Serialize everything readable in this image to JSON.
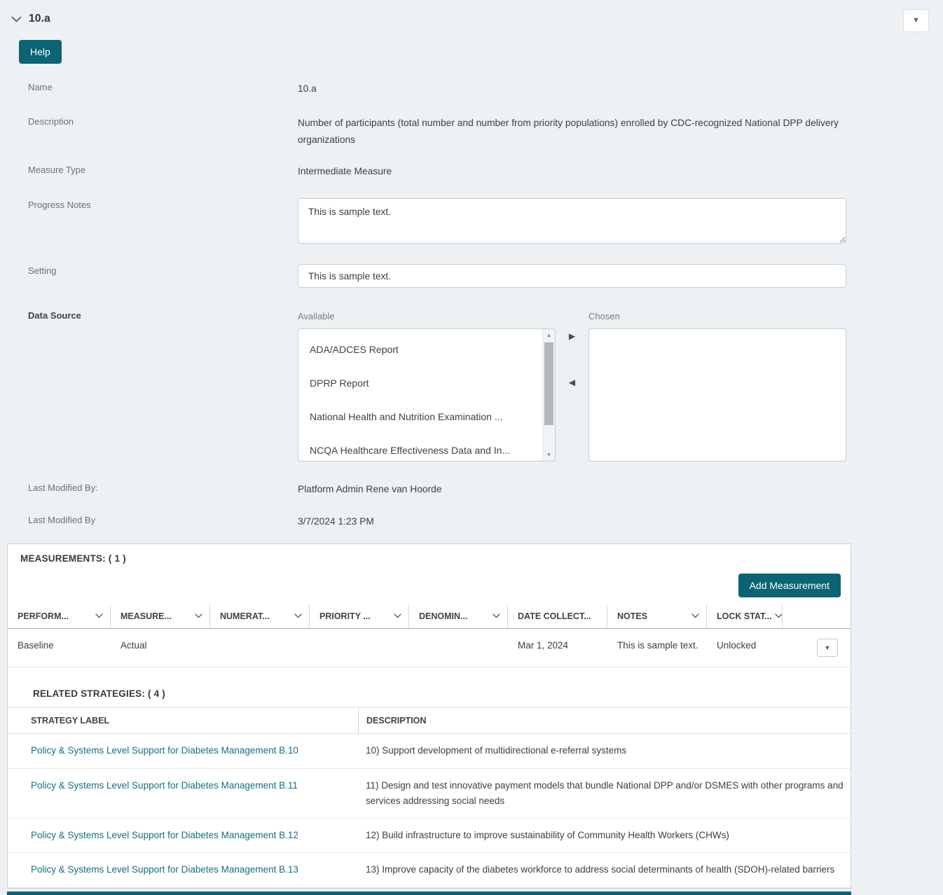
{
  "colors": {
    "accent": "#0a6473",
    "link": "#146f81",
    "page_bg": "#edf1f3"
  },
  "section": {
    "title": "10.a"
  },
  "toolbar": {
    "help_label": "Help"
  },
  "fields": {
    "name": {
      "label": "Name",
      "value": "10.a"
    },
    "description": {
      "label": "Description",
      "value": "Number of participants (total number and number from priority populations) enrolled by CDC-recognized National DPP delivery organizations"
    },
    "measure_type": {
      "label": "Measure Type",
      "value": "Intermediate Measure"
    },
    "progress_notes": {
      "label": "Progress Notes",
      "value": "This is sample text."
    },
    "setting": {
      "label": "Setting",
      "value": "This is sample text."
    },
    "data_source": {
      "label": "Data Source",
      "available_label": "Available",
      "chosen_label": "Chosen",
      "available_options": [
        "ADA/ADCES Report",
        "DPRP Report",
        "National Health and Nutrition Examination ...",
        "NCQA Healthcare Effectiveness Data and In..."
      ],
      "chosen_options": []
    },
    "last_modified_by_user": {
      "label": "Last Modified By:",
      "value": "Platform Admin Rene van Hoorde"
    },
    "last_modified_by_date": {
      "label": "Last Modified By",
      "value": "3/7/2024 1:23 PM"
    }
  },
  "measurements": {
    "title": "MEASUREMENTS: ( 1 )",
    "add_button_label": "Add Measurement",
    "columns": [
      {
        "label": "PERFORM...",
        "sortable": true
      },
      {
        "label": "MEASURE...",
        "sortable": true
      },
      {
        "label": "NUMERAT...",
        "sortable": true
      },
      {
        "label": "PRIORITY ...",
        "sortable": true
      },
      {
        "label": "DENOMIN...",
        "sortable": true
      },
      {
        "label": "DATE COLLECT...",
        "sortable": false
      },
      {
        "label": "NOTES",
        "sortable": true
      },
      {
        "label": "LOCK STAT...",
        "sortable": true
      }
    ],
    "rows": [
      {
        "performance": "Baseline",
        "measure": "Actual",
        "numerator": "",
        "priority": "",
        "denominator": "",
        "date_collected": "Mar 1, 2024",
        "notes": "This is sample text.",
        "lock_status": "Unlocked"
      }
    ]
  },
  "related_strategies": {
    "title": "RELATED STRATEGIES: ( 4 )",
    "columns": [
      "STRATEGY LABEL",
      "DESCRIPTION"
    ],
    "rows": [
      {
        "label": "Policy & Systems Level Support for Diabetes Management B.10",
        "description": "10) Support development of multidirectional e-referral systems"
      },
      {
        "label": "Policy & Systems Level Support for Diabetes Management B.11",
        "description": "11) Design and test innovative payment models that bundle National DPP and/or DSMES with other programs and services addressing social needs"
      },
      {
        "label": "Policy & Systems Level Support for Diabetes Management B.12",
        "description": "12) Build infrastructure to improve sustainability of Community Health Workers (CHWs)"
      },
      {
        "label": "Policy & Systems Level Support for Diabetes Management B.13",
        "description": "13) Improve capacity of the diabetes workforce to address social determinants of health (SDOH)-related barriers"
      }
    ]
  }
}
